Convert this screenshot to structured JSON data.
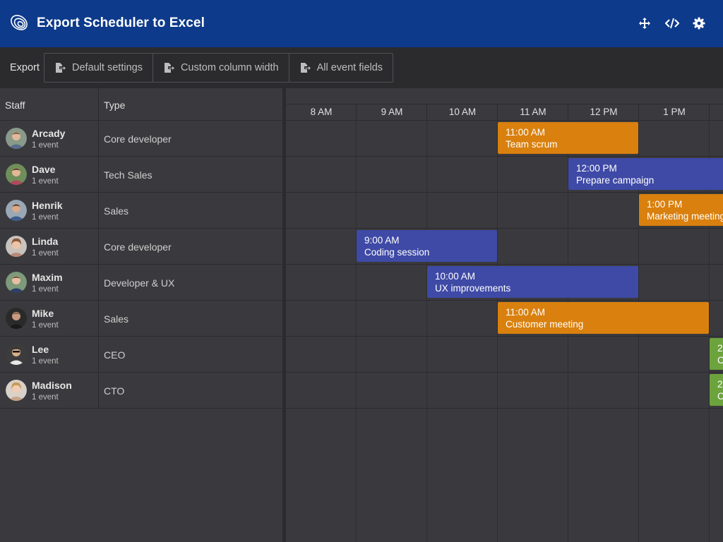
{
  "header": {
    "title": "Export Scheduler to Excel",
    "icons": [
      "logo-icon",
      "move-icon",
      "code-icon",
      "gear-icon"
    ]
  },
  "toolbar": {
    "label": "Export",
    "buttons": [
      {
        "label": "Default settings",
        "icon": "export-icon"
      },
      {
        "label": "Custom column width",
        "icon": "export-icon"
      },
      {
        "label": "All event fields",
        "icon": "export-icon"
      }
    ]
  },
  "grid": {
    "columns": {
      "staff": "Staff",
      "type": "Type"
    },
    "rows": [
      {
        "name": "Arcady",
        "events": "1 event",
        "type": "Core developer"
      },
      {
        "name": "Dave",
        "events": "1 event",
        "type": "Tech Sales"
      },
      {
        "name": "Henrik",
        "events": "1 event",
        "type": "Sales"
      },
      {
        "name": "Linda",
        "events": "1 event",
        "type": "Core developer"
      },
      {
        "name": "Maxim",
        "events": "1 event",
        "type": "Developer & UX"
      },
      {
        "name": "Mike",
        "events": "1 event",
        "type": "Sales"
      },
      {
        "name": "Lee",
        "events": "1 event",
        "type": "CEO"
      },
      {
        "name": "Madison",
        "events": "1 event",
        "type": "CTO"
      }
    ]
  },
  "timeline": {
    "ticks": [
      "8 AM",
      "9 AM",
      "10 AM",
      "11 AM",
      "12 PM",
      "1 PM"
    ],
    "events": [
      {
        "row": 0,
        "time": "11:00 AM",
        "name": "Team scrum",
        "color": "#d9800e"
      },
      {
        "row": 1,
        "time": "12:00 PM",
        "name": "Prepare campaign",
        "color": "#3f4aa6"
      },
      {
        "row": 2,
        "time": "1:00 PM",
        "name": "Marketing meeting",
        "color": "#d9800e"
      },
      {
        "row": 3,
        "time": "9:00 AM",
        "name": "Coding session",
        "color": "#3f4aa6"
      },
      {
        "row": 4,
        "time": "10:00 AM",
        "name": "UX improvements",
        "color": "#3f4aa6"
      },
      {
        "row": 5,
        "time": "11:00 AM",
        "name": "Customer meeting",
        "color": "#d9800e"
      },
      {
        "row": 6,
        "time": "2",
        "name": "C",
        "color": "#6da33d"
      },
      {
        "row": 7,
        "time": "2",
        "name": "C",
        "color": "#6da33d"
      }
    ]
  }
}
